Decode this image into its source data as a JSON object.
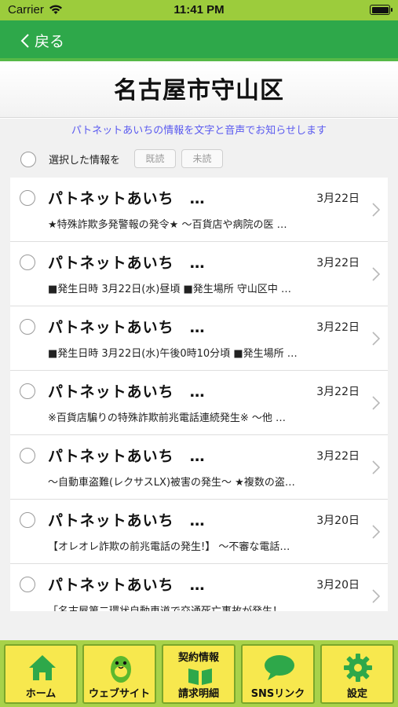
{
  "status_bar": {
    "carrier": "Carrier",
    "time": "11:41 PM"
  },
  "nav": {
    "back_label": "戻る"
  },
  "header": {
    "title": "名古屋市守山区"
  },
  "subtitle": "パトネットあいちの情報を文字と音声でお知らせします",
  "selection": {
    "label": "選択した情報を",
    "read_button": "既読",
    "unread_button": "未読"
  },
  "items": [
    {
      "title": "パトネットあいち　…",
      "date": "3月22日",
      "body": "★特殊詐欺多発警報の発令★ 〜百貨店や病院の医 …"
    },
    {
      "title": "パトネットあいち　…",
      "date": "3月22日",
      "body": "■発生日時 3月22日(水)昼頃 ■発生場所 守山区中 …"
    },
    {
      "title": "パトネットあいち　…",
      "date": "3月22日",
      "body": "■発生日時 3月22日(水)午後0時10分頃 ■発生場所 …"
    },
    {
      "title": "パトネットあいち　…",
      "date": "3月22日",
      "body": "※百貨店騙りの特殊詐欺前兆電話連続発生※ 〜他 …"
    },
    {
      "title": "パトネットあいち　…",
      "date": "3月22日",
      "body": "〜自動車盗難(レクサスLX)被害の発生〜 ★複数の盗…"
    },
    {
      "title": "パトネットあいち　…",
      "date": "3月20日",
      "body": "【オレオレ詐欺の前兆電話の発生!】 〜不審な電話…"
    },
    {
      "title": "パトネットあいち　…",
      "date": "3月20日",
      "body": "「名古屋第二環状自動車道で交通死亡事故が発生！ …"
    }
  ],
  "tabs": {
    "home": "ホーム",
    "website": "ウェブサイト",
    "contract_top": "契約情報",
    "contract_bottom": "請求明細",
    "sns": "SNSリンク",
    "settings": "設定"
  },
  "colors": {
    "nav_green": "#2ea84a",
    "tab_bar_green": "#a8d24a",
    "tab_yellow": "#f7e84e",
    "icon_green": "#2ea84a",
    "subtitle_blue": "#5a5af0"
  }
}
